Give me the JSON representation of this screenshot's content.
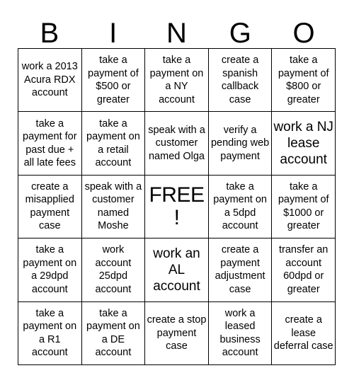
{
  "header": {
    "letters": [
      "B",
      "I",
      "N",
      "G",
      "O"
    ]
  },
  "grid": {
    "columns": 5,
    "rows": 5,
    "border_color": "#000000",
    "cell_background": "#ffffff",
    "text_color": "#000000",
    "cells": [
      {
        "text": "work a 2013 Acura RDX account",
        "size": "normal"
      },
      {
        "text": "take a payment of $500 or greater",
        "size": "normal"
      },
      {
        "text": "take a payment on a NY account",
        "size": "normal"
      },
      {
        "text": "create a spanish callback case",
        "size": "normal"
      },
      {
        "text": "take a payment of $800 or greater",
        "size": "normal"
      },
      {
        "text": "take a payment for past due + all late fees",
        "size": "normal"
      },
      {
        "text": "take a payment on a retail account",
        "size": "normal"
      },
      {
        "text": "speak with a customer named Olga",
        "size": "normal"
      },
      {
        "text": "verify a pending web payment",
        "size": "normal"
      },
      {
        "text": "work a NJ lease account",
        "size": "large"
      },
      {
        "text": "create a misapplied payment case",
        "size": "normal"
      },
      {
        "text": "speak with a customer named Moshe",
        "size": "normal"
      },
      {
        "text": "FREE!",
        "size": "free"
      },
      {
        "text": "take a payment on a 5dpd account",
        "size": "normal"
      },
      {
        "text": "take a payment of $1000 or greater",
        "size": "normal"
      },
      {
        "text": "take a payment on a 29dpd account",
        "size": "normal"
      },
      {
        "text": "work account 25dpd account",
        "size": "normal"
      },
      {
        "text": "work an AL account",
        "size": "large"
      },
      {
        "text": "create a payment adjustment case",
        "size": "normal"
      },
      {
        "text": "transfer an account 60dpd or greater",
        "size": "normal"
      },
      {
        "text": "take a payment on a R1 account",
        "size": "normal"
      },
      {
        "text": "take a payment on a DE account",
        "size": "normal"
      },
      {
        "text": "create a stop payment case",
        "size": "normal"
      },
      {
        "text": "work a leased business account",
        "size": "normal"
      },
      {
        "text": "create a lease deferral case",
        "size": "normal"
      }
    ]
  }
}
